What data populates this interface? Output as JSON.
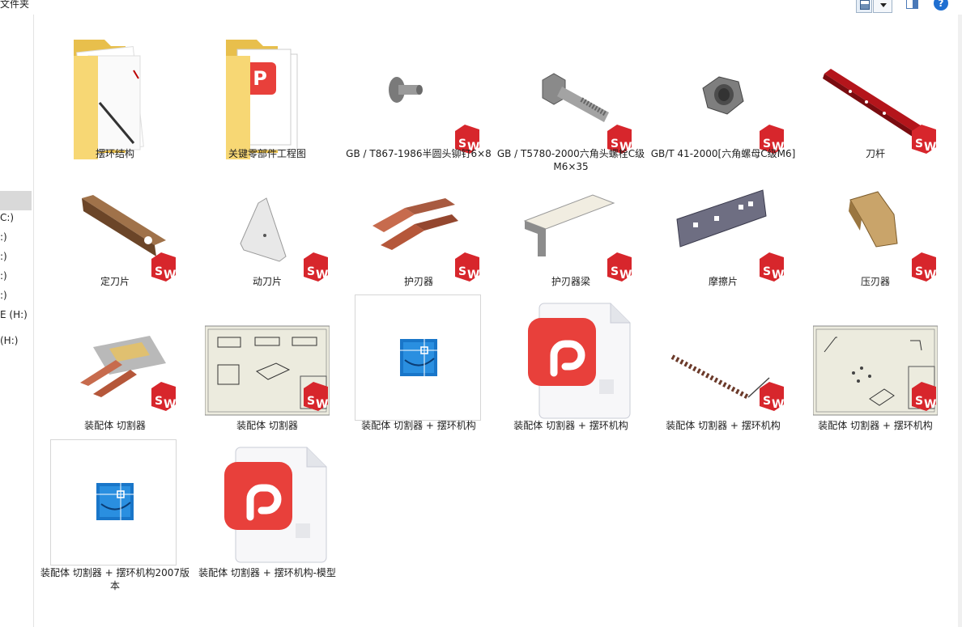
{
  "toolbar": {
    "breadcrumb": "文件夹",
    "help_label": "?"
  },
  "nav": {
    "items": [
      "C:)",
      ":)",
      ":)",
      ":)",
      ":)",
      "E (H:)",
      " (H:)"
    ]
  },
  "colors": {
    "selection": "#d9d9d9",
    "folder": "#f7d774",
    "sw_red": "#d7262c",
    "wps_red": "#e8403b",
    "cad_blue": "#1976c9"
  },
  "files": [
    {
      "name": "摆环结构",
      "icon": "folder-icon"
    },
    {
      "name": "关键零部件工程图",
      "icon": "folder-icon"
    },
    {
      "name": "GB / T867-1986半圆头铆钉6×8",
      "icon": "solidworks-part-icon"
    },
    {
      "name": "GB / T5780-2000六角头螺栓C级M6×35",
      "icon": "solidworks-part-icon"
    },
    {
      "name": "GB/T 41-2000[六角螺母C级M6]",
      "icon": "solidworks-part-icon"
    },
    {
      "name": "刀杆",
      "icon": "solidworks-part-icon"
    },
    {
      "name": "定刀片",
      "icon": "solidworks-part-icon"
    },
    {
      "name": "动刀片",
      "icon": "solidworks-part-icon"
    },
    {
      "name": "护刃器",
      "icon": "solidworks-part-icon"
    },
    {
      "name": "护刃器梁",
      "icon": "solidworks-part-icon"
    },
    {
      "name": "摩擦片",
      "icon": "solidworks-part-icon"
    },
    {
      "name": "压刃器",
      "icon": "solidworks-part-icon"
    },
    {
      "name": "装配体 切割器",
      "icon": "solidworks-assembly-icon"
    },
    {
      "name": "装配体 切割器",
      "icon": "solidworks-drawing-icon"
    },
    {
      "name": "装配体 切割器 + 摆环机构",
      "icon": "cad-file-icon"
    },
    {
      "name": "装配体 切割器 + 摆环机构",
      "icon": "wps-pdf-icon"
    },
    {
      "name": "装配体 切割器 + 摆环机构",
      "icon": "solidworks-assembly-icon"
    },
    {
      "name": "装配体 切割器 + 摆环机构",
      "icon": "solidworks-drawing-icon"
    },
    {
      "name": "装配体 切割器 + 摆环机构2007版本",
      "icon": "cad-file-icon"
    },
    {
      "name": "装配体 切割器 + 摆环机构-模型",
      "icon": "wps-pdf-icon"
    }
  ]
}
